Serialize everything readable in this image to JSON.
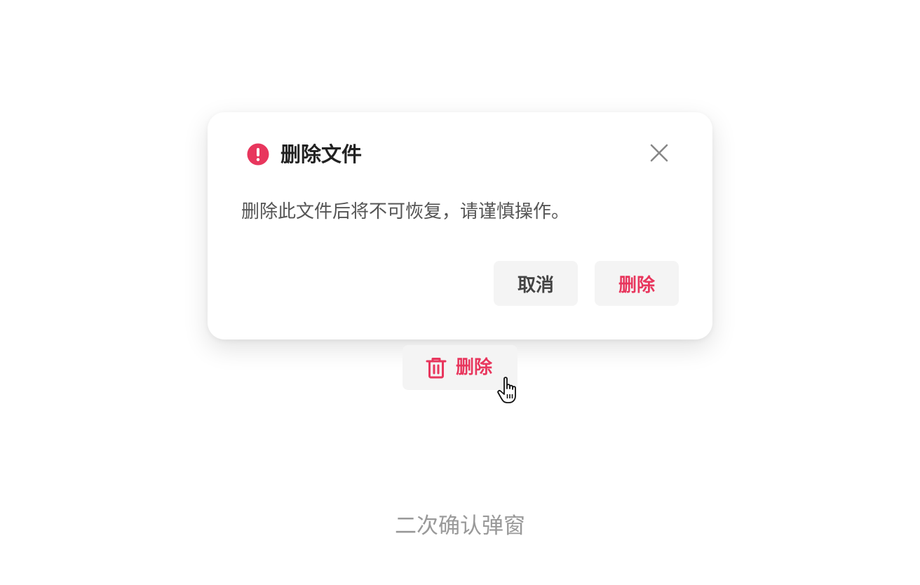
{
  "dialog": {
    "title": "删除文件",
    "message": "删除此文件后将不可恢复，请谨慎操作。",
    "cancel_label": "取消",
    "confirm_label": "删除",
    "title_icon": "alert-circle-icon",
    "close_icon": "close-icon"
  },
  "trigger": {
    "label": "删除",
    "icon": "trash-icon"
  },
  "cursor": {
    "icon": "hand-pointer-icon"
  },
  "caption": "二次确认弹窗",
  "colors": {
    "accent_red": "#e8365d",
    "button_bg": "#f4f4f4",
    "title_text": "#222222",
    "body_text": "#555555",
    "caption_text": "#999999"
  }
}
